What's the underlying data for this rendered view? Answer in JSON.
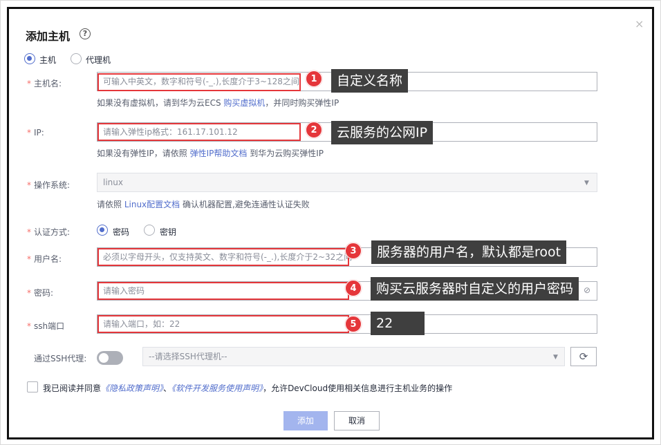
{
  "dialog": {
    "title": "添加主机",
    "help_icon": "question-circle-icon",
    "close_icon": "×"
  },
  "host_type": {
    "options": [
      {
        "label": "主机",
        "selected": true
      },
      {
        "label": "代理机",
        "selected": false
      }
    ]
  },
  "form": {
    "hostname": {
      "label": "主机名:",
      "placeholder": "可输入中英文，数字和符号(-_.),长度介于3~128之间",
      "hint_prefix": "如果没有虚拟机，请到华为云ECS ",
      "hint_link": "购买虚拟机",
      "hint_suffix": "，并同时购买弹性IP"
    },
    "ip": {
      "label": "IP:",
      "placeholder": "请输入弹性ip格式：161.17.101.12",
      "hint_prefix": "如果没有弹性IP，请依照 ",
      "hint_link": "弹性IP帮助文档",
      "hint_suffix": " 到华为云购买弹性IP"
    },
    "os": {
      "label": "操作系统:",
      "value": "linux",
      "hint_prefix": "请依照 ",
      "hint_link": "Linux配置文档",
      "hint_suffix": " 确认机器配置,避免连通性认证失败"
    },
    "auth": {
      "label": "认证方式:",
      "options": [
        {
          "label": "密码",
          "selected": true
        },
        {
          "label": "密钥",
          "selected": false
        }
      ]
    },
    "username": {
      "label": "用户名:",
      "placeholder": "必须以字母开头，仅支持英文、数字和符号(-_.),长度介于2~32之间"
    },
    "password": {
      "label": "密码:",
      "placeholder": "请输入密码",
      "eye_icon": "eye-off-icon"
    },
    "ssh_port": {
      "label": "ssh端口",
      "placeholder": "请输入端口，如：22"
    },
    "ssh_proxy": {
      "label": "通过SSH代理:",
      "toggle_on": false,
      "select_placeholder": "--请选择SSH代理机--",
      "refresh_icon": "refresh-icon"
    }
  },
  "agreement": {
    "prefix": "我已阅读并同意",
    "link1": "《隐私政策声明》",
    "sep": "、",
    "link2": "《软件开发服务使用声明》",
    "suffix": "，允许DevCloud使用相关信息进行主机业务的操作"
  },
  "buttons": {
    "add": "添加",
    "cancel": "取消"
  },
  "annotations": [
    {
      "num": "1",
      "text": "自定义名称"
    },
    {
      "num": "2",
      "text": "云服务的公网IP"
    },
    {
      "num": "3",
      "text": "服务器的用户名，默认都是root"
    },
    {
      "num": "4",
      "text": "购买云服务器时自定义的用户密码"
    },
    {
      "num": "5",
      "text": "22"
    }
  ],
  "colors": {
    "primary": "#526ecc",
    "annotation_red": "#e5363a",
    "callout_bg": "#3f3f3f"
  }
}
